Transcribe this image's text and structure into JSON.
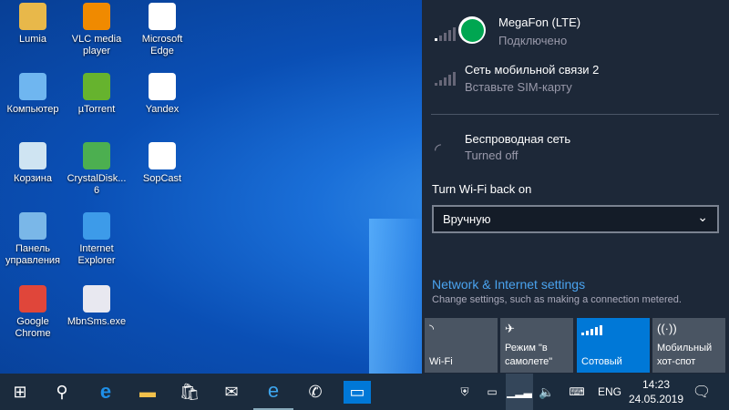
{
  "desktop": {
    "icons": [
      {
        "label": "Lumia",
        "color": "#e8b84a"
      },
      {
        "label": "VLC media player",
        "color": "#f08a00"
      },
      {
        "label": "Microsoft Edge",
        "color": "#ffffff"
      },
      {
        "label": "Компьютер",
        "color": "#6fb6f0"
      },
      {
        "label": "µTorrent",
        "color": "#66b32e"
      },
      {
        "label": "Yandex",
        "color": "#ffffff"
      },
      {
        "label": "Корзина",
        "color": "#cfe4f2"
      },
      {
        "label": "CrystalDisk... 6",
        "color": "#4caf50"
      },
      {
        "label": "SopCast",
        "color": "#ffffff"
      },
      {
        "label": "Панель управления",
        "color": "#7ab7e8"
      },
      {
        "label": "Internet Explorer",
        "color": "#3d9be9"
      },
      {
        "label": "Google Chrome",
        "color": "#e0463a"
      },
      {
        "label": "MbnSms.exe",
        "color": "#e8e8f0"
      }
    ]
  },
  "network_panel": {
    "connection1": {
      "name": "MegaFon (LTE)",
      "status": "Подключено",
      "logo_color": "#00a651"
    },
    "connection2": {
      "name": "Сеть мобильной связи 2",
      "status": "Вставьте SIM-карту"
    },
    "wifi": {
      "name": "Беспроводная сеть",
      "status": "Turned off"
    },
    "turn_wifi_label": "Turn Wi-Fi back on",
    "turn_wifi_value": "Вручную",
    "settings_link": "Network & Internet settings",
    "settings_desc": "Change settings, such as making a connection metered.",
    "tiles": [
      {
        "label": "Wi-Fi",
        "active": false
      },
      {
        "label": "Режим \"в самолете\"",
        "active": false
      },
      {
        "label": "Сотовый",
        "active": true
      },
      {
        "label": "Мобильный хот-спот",
        "active": false
      }
    ],
    "accent": "#0078d7"
  },
  "taskbar": {
    "lang": "ENG",
    "time": "14:23",
    "date": "24.05.2019"
  }
}
